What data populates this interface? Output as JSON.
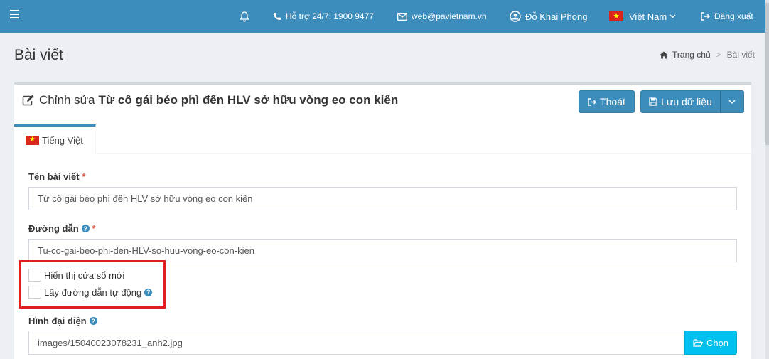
{
  "topbar": {
    "support": "Hỗ trợ 24/7: 1900 9477",
    "email": "web@pavietnam.vn",
    "user": "Đỗ Khai Phong",
    "language": "Việt Nam",
    "logout": "Đăng xuất"
  },
  "page": {
    "title": "Bài viết",
    "breadcrumb_home": "Trang chủ",
    "breadcrumb_sep": ">",
    "breadcrumb_current": "Bài viết"
  },
  "box": {
    "title_prefix": "Chỉnh sửa",
    "title_name": "Từ cô gái béo phì đến HLV sở hữu vòng eo con kiến",
    "exit_label": "Thoát",
    "save_label": "Lưu dữ liệu"
  },
  "tabs": [
    {
      "label": "Tiếng Việt"
    }
  ],
  "form": {
    "name_label": "Tên bài viết",
    "name_value": "Từ cô gái béo phì đến HLV sở hữu vòng eo con kiến",
    "path_label": "Đường dẫn",
    "path_value": "Tu-co-gai-beo-phi-den-HLV-so-huu-vong-eo-con-kien",
    "required_mark": "*",
    "help_mark": "?",
    "chk_new_window": "Hiển thị cửa sổ mới",
    "chk_auto_path": "Lấy đường dẫn tự động",
    "image_label": "Hình đại diện",
    "image_value": "images/15040023078231_anh2.jpg",
    "choose_label": "Chọn"
  }
}
